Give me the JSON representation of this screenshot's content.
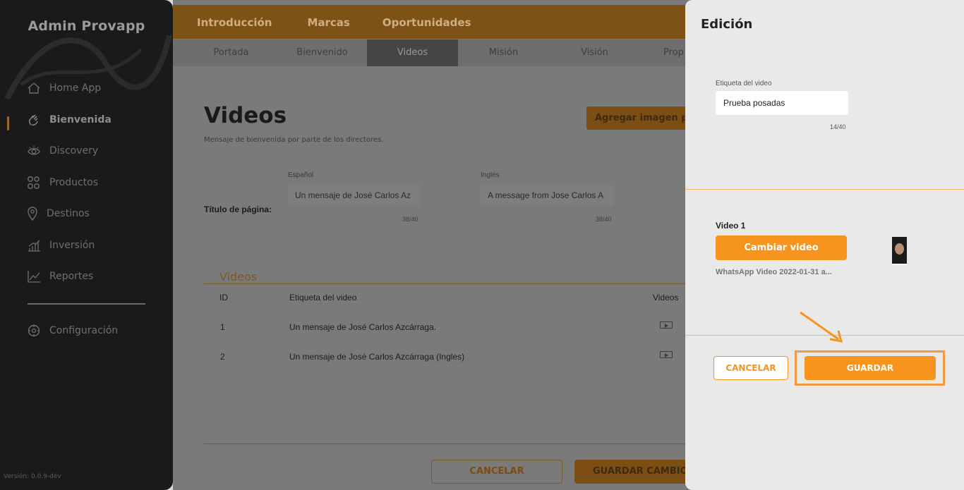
{
  "sidebar": {
    "brand": "Admin Provapp",
    "items": [
      {
        "label": "Home App",
        "icon": "home-icon"
      },
      {
        "label": "Bienvenida",
        "icon": "waving-hand-icon"
      },
      {
        "label": "Discovery",
        "icon": "eye-icon"
      },
      {
        "label": "Productos",
        "icon": "grid-icon"
      },
      {
        "label": "Destinos",
        "icon": "location-pin-icon"
      },
      {
        "label": "Inversión",
        "icon": "bar-chart-icon"
      },
      {
        "label": "Reportes",
        "icon": "line-chart-icon"
      }
    ],
    "settings_label": "Configuración",
    "version": "Versión: 0.0.9-dev"
  },
  "topbar": {
    "tabs": [
      "Introducción",
      "Marcas",
      "Oportunidades"
    ]
  },
  "subtabs": [
    "Portada",
    "Bienvenido",
    "Videos",
    "Misión",
    "Visión",
    "Prop"
  ],
  "page": {
    "title": "Videos",
    "subtitle": "Mensaje de bienvenida por parte de los directores.",
    "add_button": "Agregar imagen pre",
    "field_label": "Título de página:",
    "spanish_label": "Español",
    "spanish_value": "Un mensaje de José Carlos Az",
    "spanish_counter": "38/40",
    "english_label": "Inglés",
    "english_value": "A message from Jose Carlos A",
    "english_counter": "38/40",
    "section_title": "Videos",
    "table": {
      "headers": [
        "ID",
        "Etiqueta del video",
        "Videos"
      ],
      "rows": [
        {
          "id": "1",
          "label": "Un mensaje de José Carlos Azcárraga."
        },
        {
          "id": "2",
          "label": "Un mensaje de José Carlos Azcárraga (Ingles)"
        }
      ]
    },
    "cancel_button": "CANCELAR",
    "save_button": "GUARDAR CAMBIOS"
  },
  "drawer": {
    "title": "Edición",
    "field_label": "Etiqueta del video",
    "field_value": "Prueba posadas",
    "counter": "14/40",
    "video_label": "Video 1",
    "change_button": "Cambiar video",
    "filename": "WhatsApp Video 2022-01-31 a...",
    "cancel_button": "CANCELAR",
    "save_button": "GUARDAR"
  },
  "colors": {
    "accent": "#f7941d",
    "sidebar_bg": "#1a1a1a",
    "drawer_bg": "#e9e9e9",
    "highlight": "#f39a3e"
  }
}
